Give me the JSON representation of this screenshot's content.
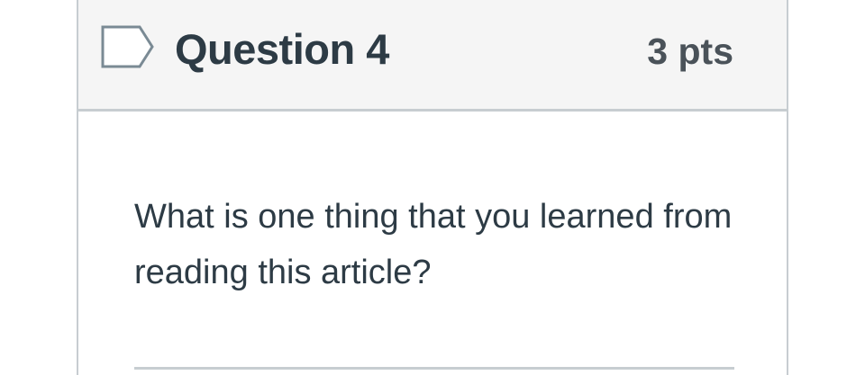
{
  "question": {
    "title": "Question 4",
    "points": "3 pts",
    "text": "What is one thing that you learned from reading this article?",
    "flag_icon": "bookmark-flag-icon"
  },
  "colors": {
    "header_bg": "#f5f5f5",
    "border": "#c7cdd1",
    "text": "#2d3b45",
    "flag_stroke": "#7a8a94"
  }
}
